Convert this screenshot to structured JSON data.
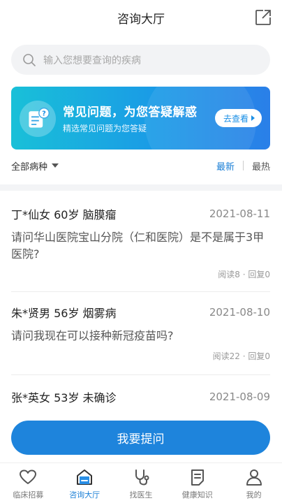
{
  "header": {
    "title": "咨询大厅",
    "share_icon": "share-external-icon"
  },
  "search": {
    "placeholder": "输入您想要查询的疾病",
    "icon": "search-icon"
  },
  "banner": {
    "title": "常见问题，为您答疑解惑",
    "subtitle": "精选常见问题为您答疑",
    "button_label": "去查看",
    "icon": "faq-document-icon"
  },
  "filter": {
    "category_label": "全部病种",
    "sort_options": [
      "最新",
      "最热"
    ],
    "active_sort": "最新"
  },
  "questions": [
    {
      "patient": "丁*仙女 60岁 脑膜瘤",
      "date": "2021-08-11",
      "question": "请问华山医院宝山分院（仁和医院）是不是属于3甲医院?",
      "stats": "阅读8 · 回复0"
    },
    {
      "patient": "朱*贤男 56岁 烟雾病",
      "date": "2021-08-10",
      "question": "请问我现在可以接种新冠疫苗吗?",
      "stats": "阅读22 · 回复0"
    },
    {
      "patient": "张*英女 53岁 未确诊",
      "date": "2021-08-09"
    }
  ],
  "ask_button": "我要提问",
  "tabbar": {
    "active": 1,
    "tabs": [
      {
        "label": "临床招募",
        "icon": "heart-icon"
      },
      {
        "label": "咨询大厅",
        "icon": "consult-hall-icon"
      },
      {
        "label": "找医生",
        "icon": "stethoscope-icon"
      },
      {
        "label": "健康知识",
        "icon": "document-icon"
      },
      {
        "label": "我的",
        "icon": "person-icon"
      }
    ]
  },
  "colors": {
    "accent": "#1e84dc",
    "active_text": "#1a7fd6"
  }
}
